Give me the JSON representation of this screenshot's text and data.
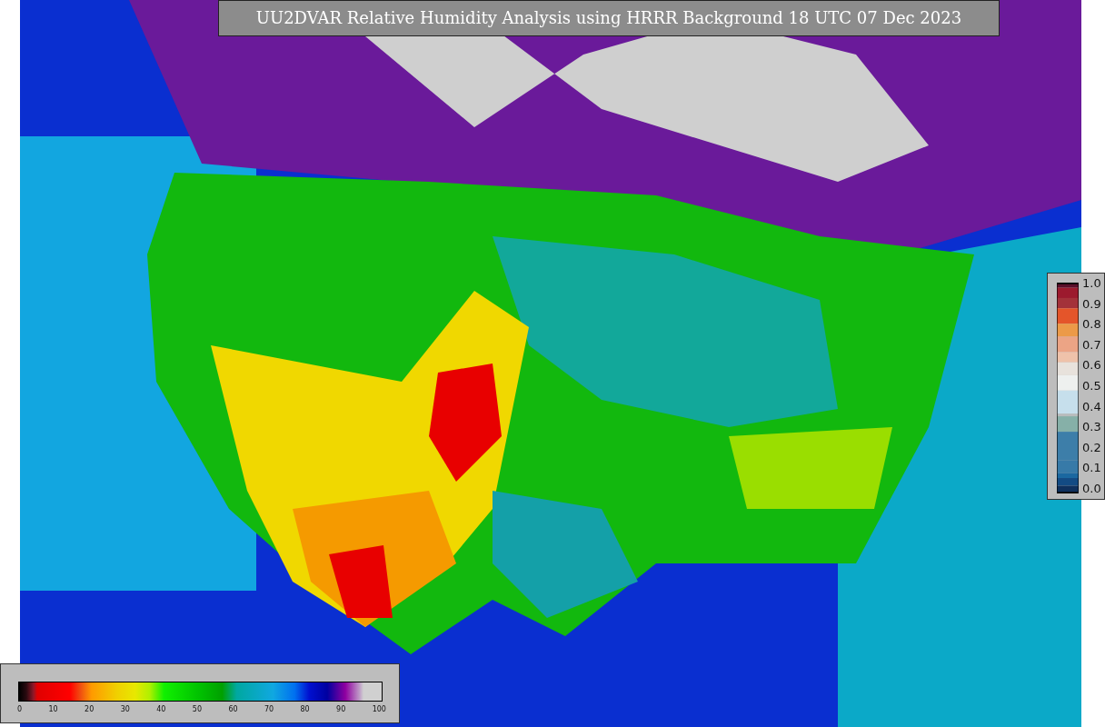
{
  "title": "UU2DVAR Relative Humidity Analysis using HRRR Background 18 UTC 07 Dec 2023",
  "observation_legend": {
    "ticks": [
      "1.0",
      "0.9",
      "0.8",
      "0.7",
      "0.6",
      "0.5",
      "0.4",
      "0.3",
      "0.2",
      "0.1",
      "0.0"
    ]
  },
  "humidity_legend": {
    "ticks": [
      "0",
      "10",
      "20",
      "30",
      "40",
      "50",
      "60",
      "70",
      "80",
      "90",
      "100"
    ]
  }
}
